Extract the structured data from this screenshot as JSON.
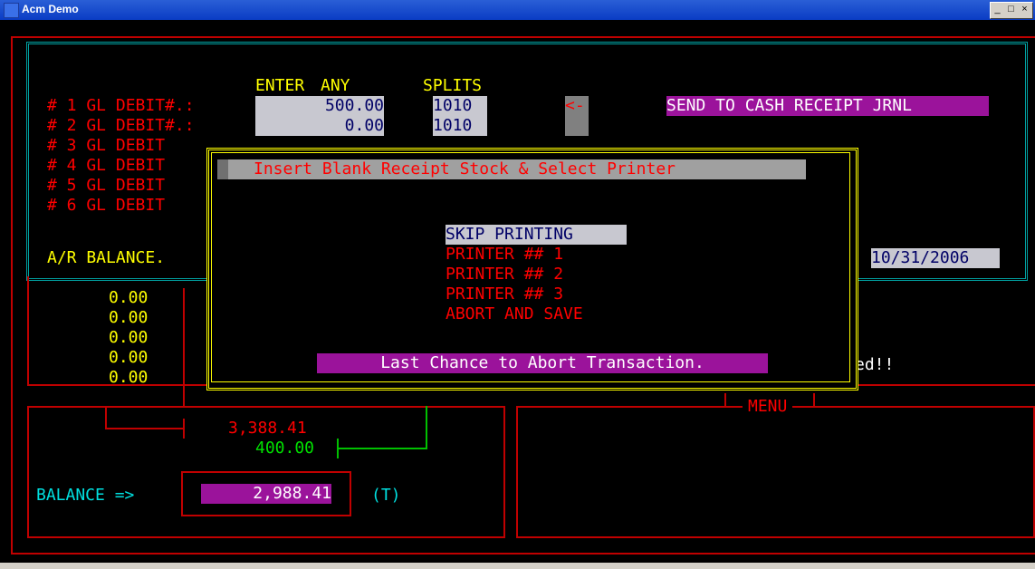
{
  "window": {
    "title": "Acm Demo",
    "btn_min": "_",
    "btn_max": "□",
    "btn_close": "×"
  },
  "header": {
    "enter": "ENTER",
    "any": "ANY",
    "splits": "SPLITS"
  },
  "gl_rows": [
    {
      "label": "# 1 GL DEBIT#.:",
      "amount": "500.00",
      "account": "1010"
    },
    {
      "label": "# 2 GL DEBIT#.:",
      "amount": "0.00",
      "account": "1010"
    },
    {
      "label": "# 3 GL DEBIT"
    },
    {
      "label": "# 4 GL DEBIT"
    },
    {
      "label": "# 5 GL DEBIT"
    },
    {
      "label": "# 6 GL DEBIT"
    }
  ],
  "arrow": "<-",
  "send_label": "SEND TO CASH RECEIPT JRNL",
  "ar_balance_label": "A/R BALANCE.",
  "date": "10/31/2006",
  "left_amounts": [
    "0.00",
    "0.00",
    "0.00",
    "0.00",
    "0.00"
  ],
  "partial_text": "ed!!",
  "menu_label": "MENU",
  "totals": {
    "debit": "3,388.41",
    "credit": "400.00"
  },
  "balance": {
    "label": "BALANCE =>",
    "value": "2,988.41",
    "flag": "(T)"
  },
  "dialog": {
    "title": "Insert Blank Receipt Stock & Select Printer",
    "options": [
      "SKIP PRINTING",
      "PRINTER ## 1",
      "PRINTER ## 2",
      "PRINTER ## 3",
      "ABORT AND SAVE"
    ],
    "selected_index": 0,
    "footer": "Last Chance to Abort Transaction."
  },
  "colors": {
    "yellow": "#ffff00",
    "red": "#ff0000",
    "teal": "#00a0a0",
    "magenta": "#9b139b"
  }
}
